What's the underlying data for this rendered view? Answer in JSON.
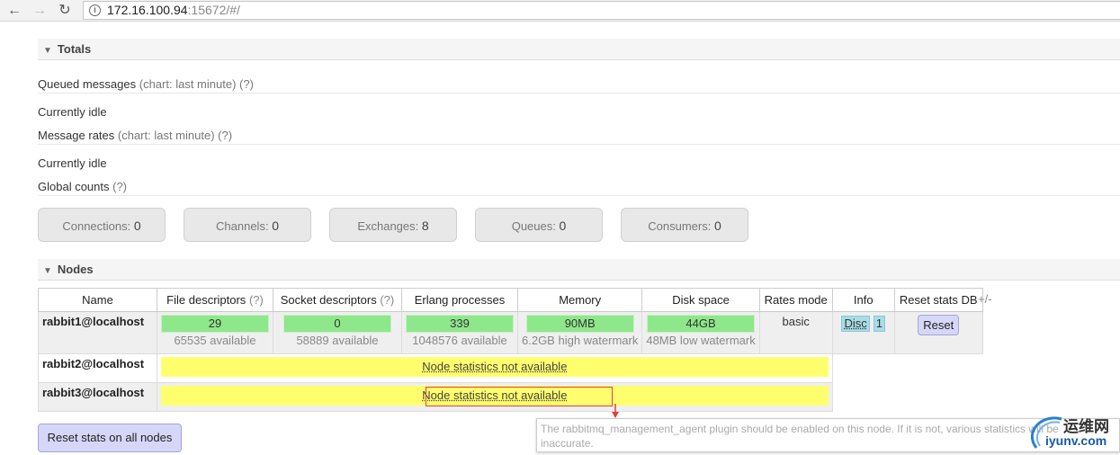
{
  "browser": {
    "url_host": "172.16.100.94",
    "url_path": ":15672/#/"
  },
  "totals": {
    "title": "Totals",
    "queued_label": "Queued messages",
    "queued_hint": "(chart: last minute)",
    "help": "(?)",
    "idle1": "Currently idle",
    "rates_label": "Message rates",
    "rates_hint": "(chart: last minute)",
    "idle2": "Currently idle",
    "global_label": "Global counts"
  },
  "counts": [
    {
      "label": "Connections:",
      "value": "0"
    },
    {
      "label": "Channels:",
      "value": "0"
    },
    {
      "label": "Exchanges:",
      "value": "8"
    },
    {
      "label": "Queues:",
      "value": "0"
    },
    {
      "label": "Consumers:",
      "value": "0"
    }
  ],
  "nodes": {
    "title": "Nodes",
    "plusminus": "+/-",
    "columns": [
      "Name",
      "File descriptors",
      "Socket descriptors",
      "Erlang processes",
      "Memory",
      "Disk space",
      "Rates mode",
      "Info",
      "Reset stats DB"
    ],
    "help": "(?)",
    "row1": {
      "name": "rabbit1@localhost",
      "fd": "29",
      "fd_sub": "65535 available",
      "sd": "0",
      "sd_sub": "58889 available",
      "ep": "339",
      "ep_sub": "1048576 available",
      "mem": "90MB",
      "mem_sub": "6.2GB high watermark",
      "disk": "44GB",
      "disk_sub": "48MB low watermark",
      "rates": "basic",
      "info1": "Disc",
      "info2": "1",
      "reset": "Reset"
    },
    "row2": {
      "name": "rabbit2@localhost",
      "status": "Node statistics not available"
    },
    "row3": {
      "name": "rabbit3@localhost",
      "status": "Node statistics not available"
    }
  },
  "reset_all": "Reset stats on all nodes",
  "tooltip": {
    "line1": "The rabbitmq_management_agent plugin should be enabled on this node. If it is not, various statistics will be",
    "line2": "inaccurate."
  },
  "watermark": {
    "cn": "运维网",
    "domain": "iyunv.com"
  },
  "colors": {
    "accent": "#8fe78b",
    "warn": "#ffff6e",
    "button": "#d6d6f9"
  }
}
